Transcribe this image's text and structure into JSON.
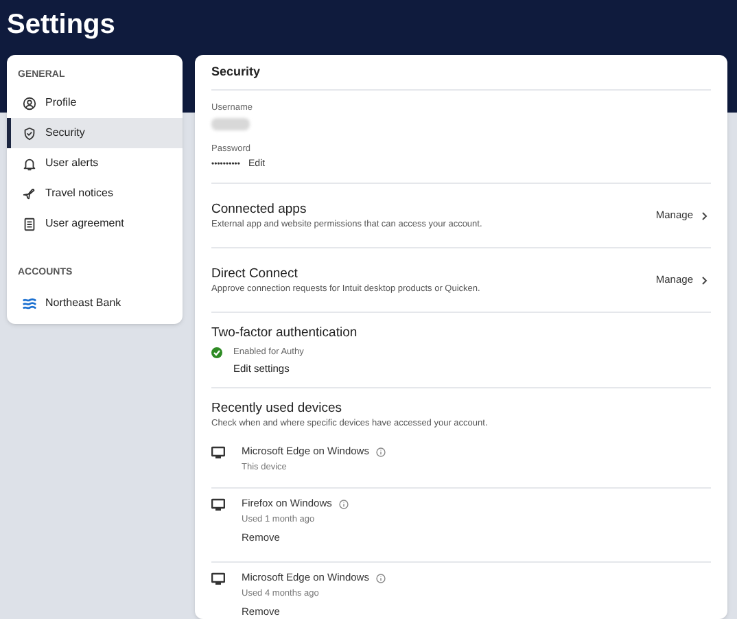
{
  "page_title": "Settings",
  "sidebar": {
    "sections": [
      {
        "heading": "GENERAL",
        "items": [
          {
            "label": "Profile",
            "selected": false
          },
          {
            "label": "Security",
            "selected": true
          },
          {
            "label": "User alerts",
            "selected": false
          },
          {
            "label": "Travel notices",
            "selected": false
          },
          {
            "label": "User agreement",
            "selected": false
          }
        ]
      },
      {
        "heading": "ACCOUNTS",
        "items": [
          {
            "label": "Northeast Bank",
            "selected": false
          }
        ]
      }
    ]
  },
  "main": {
    "title": "Security",
    "credentials": {
      "username_label": "Username",
      "password_label": "Password",
      "password_value": "••••••••••",
      "edit_link": "Edit"
    },
    "manage_sections": [
      {
        "title": "Connected apps",
        "description": "External app and website permissions that can access your account.",
        "action": "Manage"
      },
      {
        "title": "Direct Connect",
        "description": "Approve connection requests for Intuit desktop products or Quicken.",
        "action": "Manage"
      }
    ],
    "two_factor": {
      "title": "Two-factor authentication",
      "enabled": true,
      "status": "Enabled for Authy",
      "link": "Edit settings"
    },
    "devices": {
      "title": "Recently used devices",
      "description": "Check when and where specific devices have accessed your account.",
      "items": [
        {
          "name": "Microsoft Edge on Windows",
          "detail": "This device"
        },
        {
          "name": "Firefox on Windows",
          "detail": "Used 1 month ago",
          "action": "Remove"
        },
        {
          "name": "Microsoft Edge on Windows",
          "detail": "Used 4 months ago",
          "action": "Remove"
        }
      ]
    }
  }
}
